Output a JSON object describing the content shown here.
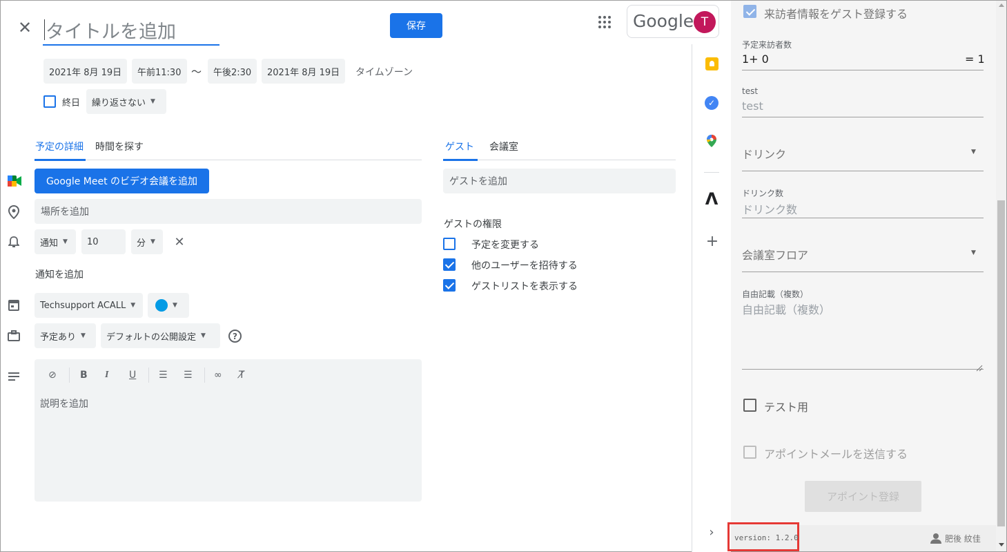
{
  "header": {
    "title_placeholder": "タイトルを追加",
    "save_label": "保存",
    "google_label": "Google",
    "avatar_letter": "T"
  },
  "datetime": {
    "start_date": "2021年 8月 19日",
    "start_time": "午前11:30",
    "separator": "〜",
    "end_time": "午後2:30",
    "end_date": "2021年 8月 19日",
    "timezone": "タイムゾーン",
    "all_day_label": "終日",
    "repeat_label": "繰り返さない"
  },
  "left_tabs": {
    "details": "予定の詳細",
    "find_time": "時間を探す"
  },
  "details": {
    "meet_button": "Google Meet のビデオ会議を追加",
    "location_placeholder": "場所を追加",
    "notify_type": "通知",
    "notify_value": "10",
    "notify_unit": "分",
    "add_notification": "通知を追加",
    "calendar_name": "Techsupport ACALL",
    "calendar_color": "#039be5",
    "busy_status": "予定あり",
    "visibility": "デフォルトの公開設定",
    "help_glyph": "?",
    "description_placeholder": "説明を追加"
  },
  "right_tabs": {
    "guests": "ゲスト",
    "rooms": "会議室"
  },
  "guests": {
    "add_guest_placeholder": "ゲストを追加",
    "permissions_title": "ゲストの権限",
    "permissions": [
      {
        "label": "予定を変更する",
        "checked": false
      },
      {
        "label": "他のユーザーを招待する",
        "checked": true
      },
      {
        "label": "ゲストリストを表示する",
        "checked": true
      }
    ]
  },
  "addon": {
    "register_visitor_label": "来訪者情報をゲスト登録する",
    "visitor_count_label": "予定来訪者数",
    "visitor_count_expr": "1+ 0",
    "visitor_count_total": "= 1",
    "test_label": "test",
    "test_placeholder": "test",
    "drink_select": "ドリンク",
    "drink_count_label": "ドリンク数",
    "drink_count_placeholder": "ドリンク数",
    "floor_select": "会議室フロア",
    "free_text_label": "自由記載（複数）",
    "free_text_placeholder": "自由記載（複数）",
    "test_checkbox_label": "テスト用",
    "send_mail_label": "アポイントメールを送信する",
    "submit_button": "アポイント登録",
    "version": "version: 1.2.0",
    "user_name": "肥後 紋佳"
  },
  "colors": {
    "accent": "#1a73e8",
    "highlight_box": "#e53935",
    "avatar": "#c2185b"
  }
}
